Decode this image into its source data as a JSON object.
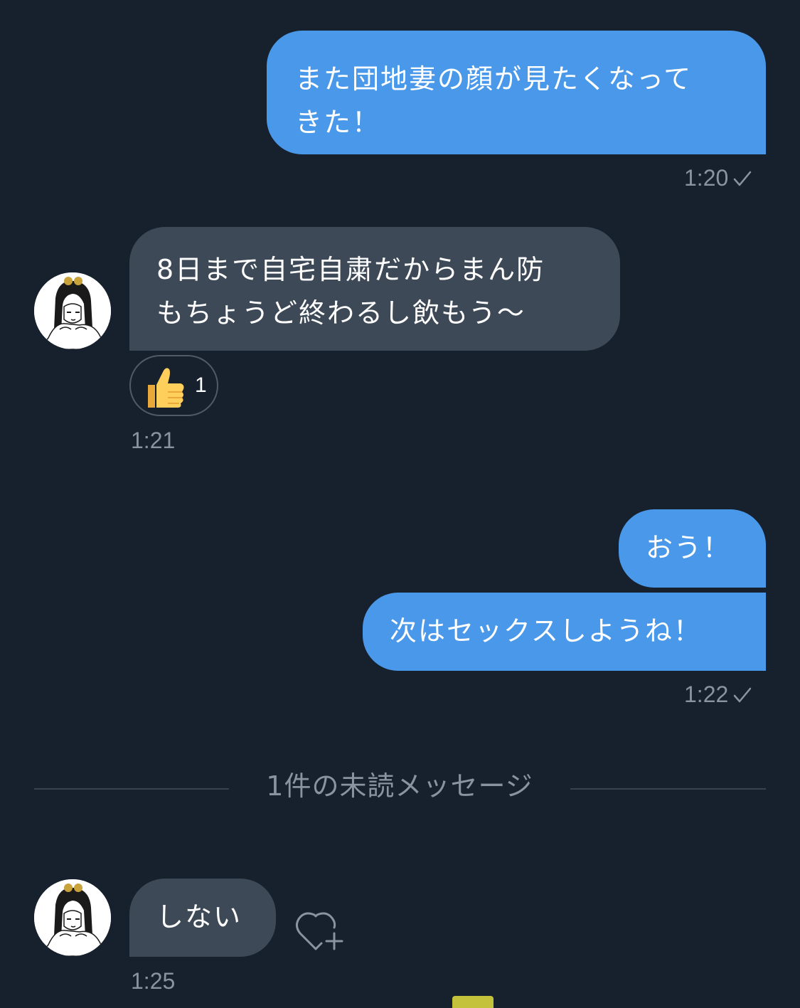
{
  "messages": [
    {
      "side": "sent",
      "text": "また団地妻の顔が見たくなって\nきた！",
      "time": "1:20"
    },
    {
      "side": "received",
      "text": "8日まで自宅自粛だからまん防\nもちょうど終わるし飲もう〜",
      "reaction": {
        "emoji": "thumbs-up",
        "count": "1"
      },
      "time": "1:21"
    },
    {
      "side": "sent",
      "text": "おう！"
    },
    {
      "side": "sent",
      "text": "次はセックスしようね！",
      "time": "1:22"
    },
    {
      "side": "received",
      "text": "しない",
      "time": "1:25"
    }
  ],
  "unread_divider": "1件の未読メッセージ",
  "colors": {
    "background": "#17202d",
    "sent_bubble": "#4a98e9",
    "received_bubble": "#3d4956",
    "meta_text": "#8a949e"
  },
  "icons": {
    "read_receipt": "check-icon",
    "add_reaction": "heart-plus-icon",
    "reaction": "thumbs-up-icon"
  }
}
